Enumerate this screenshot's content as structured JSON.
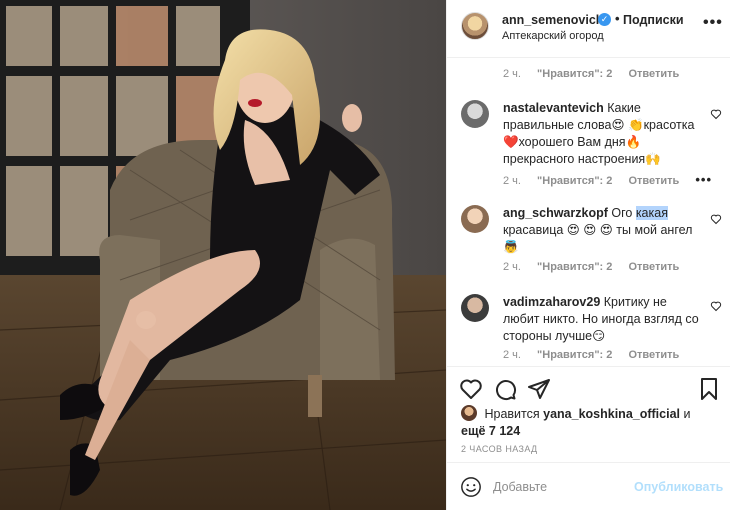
{
  "post": {
    "username": "ann_semenovich",
    "verified_icon": "verified-badge-icon",
    "follow_label": "Подписки",
    "location": "Аптекарский огород"
  },
  "top_meta": {
    "time": "2 ч.",
    "likes": "\"Нравится\": 2",
    "reply": "Ответить"
  },
  "comments": [
    {
      "username": "nastalevantevich",
      "text": "Какие правильные слова😍 👏красотка ❤️хорошего Вам дня🔥 прекрасного настроения🙌",
      "time": "2 ч.",
      "likes": "\"Нравится\": 2",
      "reply": "Ответить",
      "more": "•••"
    },
    {
      "username": "ang_schwarzkopf",
      "text_before": "Ого ",
      "text_selected": "какая",
      "text_after": " красавица 😍 😍 😍 ты мой ангел 👼",
      "time": "2 ч.",
      "likes": "\"Нравится\": 2",
      "reply": "Ответить"
    },
    {
      "username": "vadimzaharov29",
      "text": "Критику не любит никто. Но иногда взгляд со стороны лучше😏",
      "time": "2 ч.",
      "likes": "\"Нравится\": 2",
      "reply": "Ответить"
    }
  ],
  "likes_summary": {
    "prefix": "Нравится",
    "user": "yana_koshkina_official",
    "joiner": "и",
    "rest": "ещё 7 124"
  },
  "time_ago": "2 ЧАСОВ НАЗАД",
  "composer": {
    "placeholder": "Добавьте",
    "publish_label": "Опубликовать"
  },
  "colors": {
    "link_blue": "#3897f0",
    "publish_disabled": "#b2dffc",
    "meta_gray": "#8e8e8e",
    "text": "#262626"
  },
  "icons": [
    "heart-icon",
    "comment-icon",
    "share-icon",
    "bookmark-icon",
    "emoji-icon",
    "more-icon"
  ]
}
